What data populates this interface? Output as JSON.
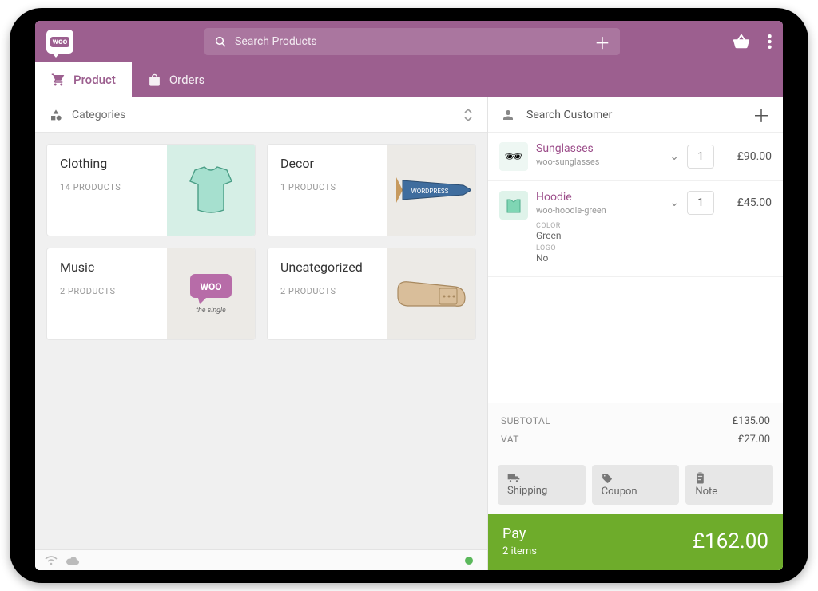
{
  "header": {
    "logo_text": "woo",
    "search_placeholder": "Search Products"
  },
  "tabs": {
    "product": "Product",
    "orders": "Orders"
  },
  "categories_header": "Categories",
  "categories": [
    {
      "name": "Clothing",
      "count": "14 PRODUCTS"
    },
    {
      "name": "Decor",
      "count": "1 PRODUCTS"
    },
    {
      "name": "Music",
      "count": "2 PRODUCTS"
    },
    {
      "name": "Uncategorized",
      "count": "2 PRODUCTS"
    }
  ],
  "customer": {
    "placeholder": "Search Customer"
  },
  "cart": [
    {
      "name": "Sunglasses",
      "sku": "woo-sunglasses",
      "qty": "1",
      "price": "£90.00"
    },
    {
      "name": "Hoodie",
      "sku": "woo-hoodie-green",
      "qty": "1",
      "price": "£45.00",
      "attr1_label": "COLOR",
      "attr1_value": "Green",
      "attr2_label": "LOGO",
      "attr2_value": "No"
    }
  ],
  "totals": {
    "subtotal_label": "SUBTOTAL",
    "subtotal": "£135.00",
    "vat_label": "VAT",
    "vat": "£27.00"
  },
  "actions": {
    "shipping": "Shipping",
    "coupon": "Coupon",
    "note": "Note"
  },
  "pay": {
    "label": "Pay",
    "items": "2 items",
    "total": "£162.00"
  }
}
